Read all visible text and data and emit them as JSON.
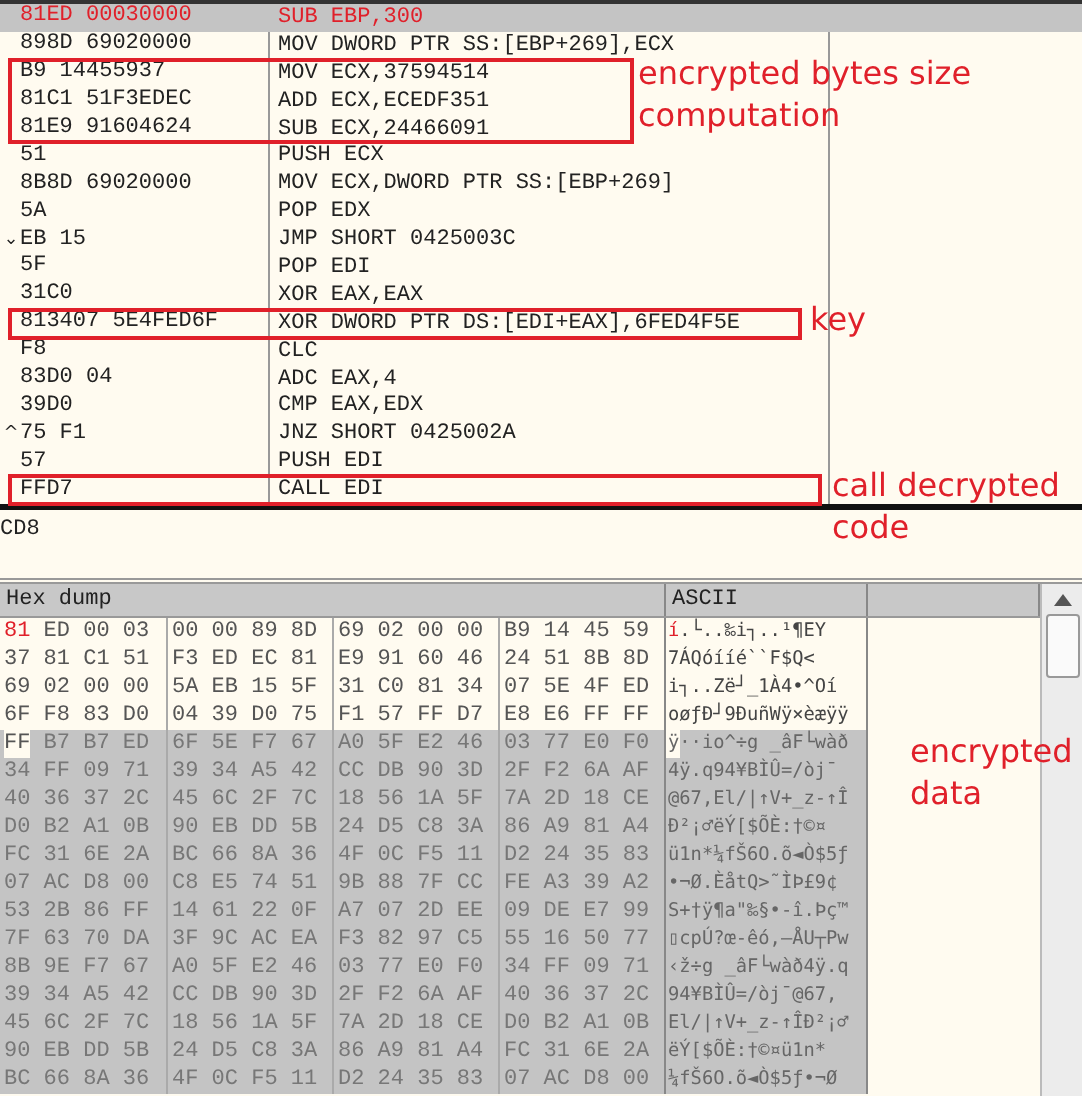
{
  "disassembly": {
    "rows": [
      {
        "hex": "81ED 00030000",
        "instruction": "SUB EBP,300",
        "selected": true,
        "boxed": false
      },
      {
        "hex": "898D 69020000",
        "instruction": "MOV DWORD PTR SS:[EBP+269],ECX",
        "selected": false,
        "boxed": false
      },
      {
        "hex": "B9 14455937",
        "instruction": "MOV ECX,37594514",
        "selected": false,
        "boxed": true
      },
      {
        "hex": "81C1 51F3EDEC",
        "instruction": "ADD ECX,ECEDF351",
        "selected": false,
        "boxed": true
      },
      {
        "hex": "81E9 91604624",
        "instruction": "SUB ECX,24466091",
        "selected": false,
        "boxed": true
      },
      {
        "hex": "51",
        "instruction": "PUSH ECX",
        "selected": false,
        "boxed": false
      },
      {
        "hex": "8B8D 69020000",
        "instruction": "MOV ECX,DWORD PTR SS:[EBP+269]",
        "selected": false,
        "boxed": false
      },
      {
        "hex": "5A",
        "instruction": "POP EDX",
        "selected": false,
        "boxed": false
      },
      {
        "hex": "EB 15",
        "jump_mark": "⌄",
        "instruction": "JMP SHORT 0425003C",
        "selected": false,
        "boxed": false
      },
      {
        "hex": "5F",
        "instruction": "POP EDI",
        "selected": false,
        "boxed": false
      },
      {
        "hex": "31C0",
        "instruction": "XOR EAX,EAX",
        "selected": false,
        "boxed": false
      },
      {
        "hex": "813407 5E4FED6F",
        "instruction": "XOR DWORD PTR DS:[EDI+EAX],6FED4F5E",
        "selected": false,
        "boxed": true
      },
      {
        "hex": "F8",
        "instruction": "CLC",
        "selected": false,
        "boxed": false
      },
      {
        "hex": "83D0 04",
        "instruction": "ADC EAX,4",
        "selected": false,
        "boxed": false
      },
      {
        "hex": "39D0",
        "instruction": "CMP EAX,EDX",
        "selected": false,
        "boxed": false
      },
      {
        "hex": "75 F1",
        "jump_mark": "^",
        "instruction": "JNZ SHORT 0425002A",
        "selected": false,
        "boxed": false
      },
      {
        "hex": "57",
        "instruction": "PUSH EDI",
        "selected": false,
        "boxed": false
      },
      {
        "hex": "FFD7",
        "instruction": "CALL EDI",
        "selected": false,
        "boxed": true
      }
    ]
  },
  "info": {
    "text": "CD8"
  },
  "dump": {
    "columns": [
      "Hex dump",
      "ASCII"
    ],
    "rows": [
      {
        "groups": [
          "81 ED 00 03",
          "00 00 89 8D",
          "69 02 00 00",
          "B9 14 45 59"
        ],
        "ascii": "í.└..‰i┐..¹¶EY",
        "current": true,
        "lead_selected": false,
        "selected": false
      },
      {
        "groups": [
          "37 81 C1 51",
          "F3 ED EC 81",
          "E9 91 60 46",
          "24 51 8B 8D"
        ],
        "ascii": "7ÁQóííé``F$Q<",
        "current": false,
        "lead_selected": false,
        "selected": false
      },
      {
        "groups": [
          "69 02 00 00",
          "5A EB 15 5F",
          "31 C0 81 34",
          "07 5E 4F ED"
        ],
        "ascii": "i┐..Zë┘_1À4•^Oí",
        "current": false,
        "lead_selected": false,
        "selected": false
      },
      {
        "groups": [
          "6F F8 83 D0",
          "04 39 D0 75",
          "F1 57 FF D7",
          "E8 E6 FF FF"
        ],
        "ascii": "oøƒÐ┘9ÐuñWÿ×èæÿÿ",
        "current": false,
        "lead_selected": false,
        "selected": false
      },
      {
        "groups": [
          "FF B7 B7 ED",
          "6F 5E F7 67",
          "A0 5F E2 46",
          "03 77 E0 F0"
        ],
        "ascii": "ÿ··io^÷g _âF└wàð",
        "current": false,
        "lead_selected": false,
        "selected": true
      },
      {
        "groups": [
          "34 FF 09 71",
          "39 34 A5 42",
          "CC DB 90 3D",
          "2F F2 6A AF"
        ],
        "ascii": "4ÿ.q94¥BÌÛ=/òj¯",
        "current": false,
        "lead_selected": true,
        "selected": true
      },
      {
        "groups": [
          "40 36 37 2C",
          "45 6C 2F 7C",
          "18 56 1A 5F",
          "7A 2D 18 CE"
        ],
        "ascii": "@67,El/|↑V+_z-↑Î",
        "current": false,
        "lead_selected": true,
        "selected": true
      },
      {
        "groups": [
          "D0 B2 A1 0B",
          "90 EB DD 5B",
          "24 D5 C8 3A",
          "86 A9 81 A4"
        ],
        "ascii": "Ð²¡♂ëÝ[$ÕÈ:†©¤",
        "current": false,
        "lead_selected": true,
        "selected": true
      },
      {
        "groups": [
          "FC 31 6E 2A",
          "BC 66 8A 36",
          "4F 0C F5 11",
          "D2 24 35 83"
        ],
        "ascii": "ü1n*¼fŠ6O.õ◄Ò$5ƒ",
        "current": false,
        "lead_selected": true,
        "selected": true
      },
      {
        "groups": [
          "07 AC D8 00",
          "C8 E5 74 51",
          "9B 88 7F CC",
          "FE A3 39 A2"
        ],
        "ascii": "•¬Ø.ÈåtQ>˜ÌÞ£9¢",
        "current": false,
        "lead_selected": true,
        "selected": true
      },
      {
        "groups": [
          "53 2B 86 FF",
          "14 61 22 0F",
          "A7 07 2D EE",
          "09 DE E7 99"
        ],
        "ascii": "S+†ÿ¶a\"‰§•-î.Þç™",
        "current": false,
        "lead_selected": true,
        "selected": true
      },
      {
        "groups": [
          "7F 63 70 DA",
          "3F 9C AC EA",
          "F3 82 97 C5",
          "55 16 50 77"
        ],
        "ascii": "▯cpÚ?œ-êó‚—ÅU┬Pw",
        "current": false,
        "lead_selected": true,
        "selected": true
      },
      {
        "groups": [
          "8B 9E F7 67",
          "A0 5F E2 46",
          "03 77 E0 F0",
          "34 FF 09 71"
        ],
        "ascii": "‹ž÷g _âF└wàð4ÿ.q",
        "current": false,
        "lead_selected": true,
        "selected": true
      },
      {
        "groups": [
          "39 34 A5 42",
          "CC DB 90 3D",
          "2F F2 6A AF",
          "40 36 37 2C"
        ],
        "ascii": "94¥BÌÛ=/òj¯@67,",
        "current": false,
        "lead_selected": true,
        "selected": true
      },
      {
        "groups": [
          "45 6C 2F 7C",
          "18 56 1A 5F",
          "7A 2D 18 CE",
          "D0 B2 A1 0B"
        ],
        "ascii": "El/|↑V+_z-↑ÎÐ²¡♂",
        "current": false,
        "lead_selected": true,
        "selected": true
      },
      {
        "groups": [
          "90 EB DD 5B",
          "24 D5 C8 3A",
          "86 A9 81 A4",
          "FC 31 6E 2A"
        ],
        "ascii": "ëÝ[$ÕÈ:†©¤ü1n*",
        "current": false,
        "lead_selected": true,
        "selected": true
      },
      {
        "groups": [
          "BC 66 8A 36",
          "4F 0C F5 11",
          "D2 24 35 83",
          "07 AC D8 00"
        ],
        "ascii": "¼fŠ6O.õ◄Ò$5ƒ•¬Ø",
        "current": false,
        "lead_selected": true,
        "selected": true
      }
    ]
  },
  "annotations": [
    {
      "text": "encrypted bytes size\ncomputation"
    },
    {
      "text": "key"
    },
    {
      "text": "call decrypted\ncode"
    },
    {
      "text": "encrypted\ndata"
    }
  ]
}
